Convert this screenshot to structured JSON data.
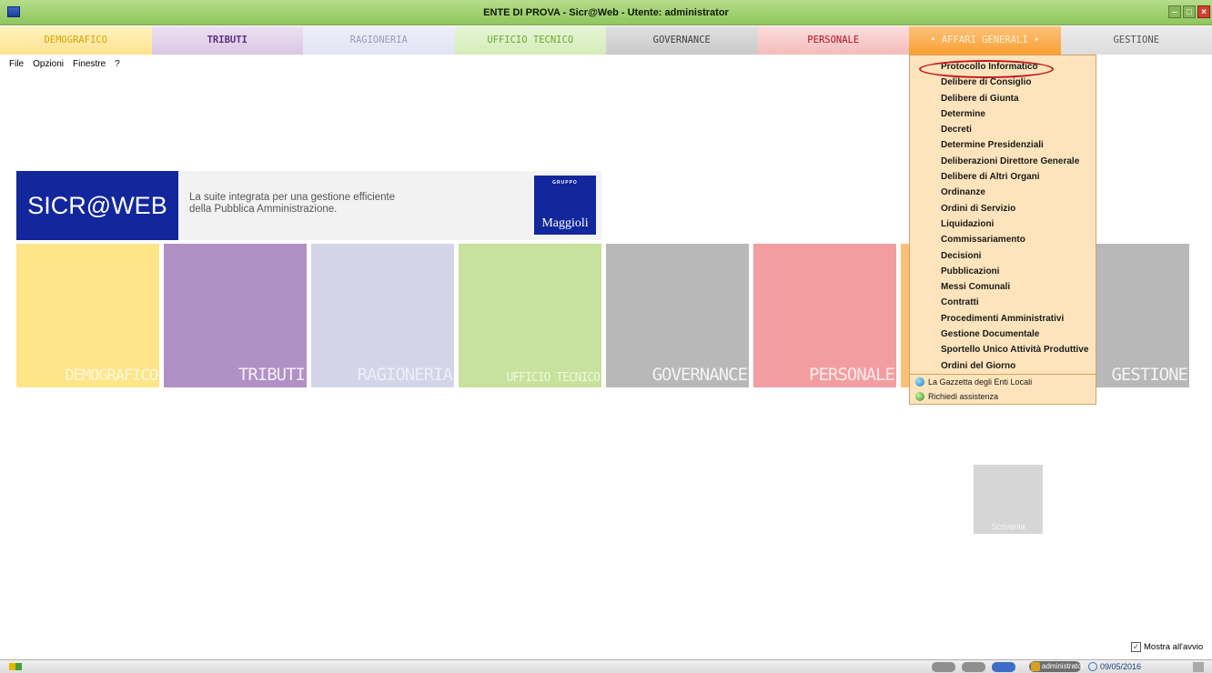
{
  "window": {
    "title": "ENTE DI PROVA  -  Sicr@Web  -  Utente: administrator",
    "controls": [
      "minimize",
      "maximize",
      "close"
    ]
  },
  "tabs": [
    {
      "label": "DEMOGRAFICO"
    },
    {
      "label": "TRIBUTI"
    },
    {
      "label": "RAGIONERIA"
    },
    {
      "label": "UFFICIO TECNICO"
    },
    {
      "label": "GOVERNANCE"
    },
    {
      "label": "PERSONALE"
    },
    {
      "label": "• AFFARI GENERALI •",
      "active": true
    },
    {
      "label": "GESTIONE"
    }
  ],
  "menubar": {
    "file": "File",
    "opzioni": "Opzioni",
    "finestre": "Finestre",
    "help": "?"
  },
  "banner": {
    "logo": "SICR@WEB",
    "tagline": "La suite integrata per una gestione efficiente\ndella Pubblica Amministrazione.",
    "brand_small": "GRUPPO",
    "brand": "Maggioli"
  },
  "tiles": {
    "demografico": "DEMOGRAFICO",
    "tributi": "TRIBUTI",
    "ragioneria": "RAGIONERIA",
    "tecnico": "UFFICIO TECNICO",
    "governance": "GOVERNANCE",
    "personale": "PERSONALE",
    "gestione": "GESTIONE",
    "scrivania": "Scrivania"
  },
  "dropdown": {
    "items": [
      "Protocollo Informatico",
      "Delibere di Consiglio",
      "Delibere di Giunta",
      "Determine",
      "Decreti",
      "Determine Presidenziali",
      "Deliberazioni Direttore Generale",
      "Delibere di Altri Organi",
      "Ordinanze",
      "Ordini di Servizio",
      "Liquidazioni",
      "Commissariamento",
      "Decisioni",
      "Pubblicazioni",
      "Messi Comunali",
      "Contratti",
      "Procedimenti Amministrativi",
      "Gestione Documentale",
      "Sportello Unico Attività Produttive",
      "Ordini del Giorno"
    ],
    "highlighted_index": 0,
    "extra": [
      {
        "label": "La Gazzetta degli Enti Locali",
        "icon": "globe-icon"
      },
      {
        "label": "Richiedi assistenza",
        "icon": "help-globe-icon"
      }
    ]
  },
  "footer": {
    "mostra_label": "Mostra all'avvio",
    "mostra_checked": true,
    "user": "administrator",
    "date": "09/05/2016"
  },
  "colors": {
    "titlebar": "#8fc65d",
    "affari_accent": "#f8a033",
    "banner_blue": "#12279c",
    "highlight_circle": "#c3161c"
  }
}
